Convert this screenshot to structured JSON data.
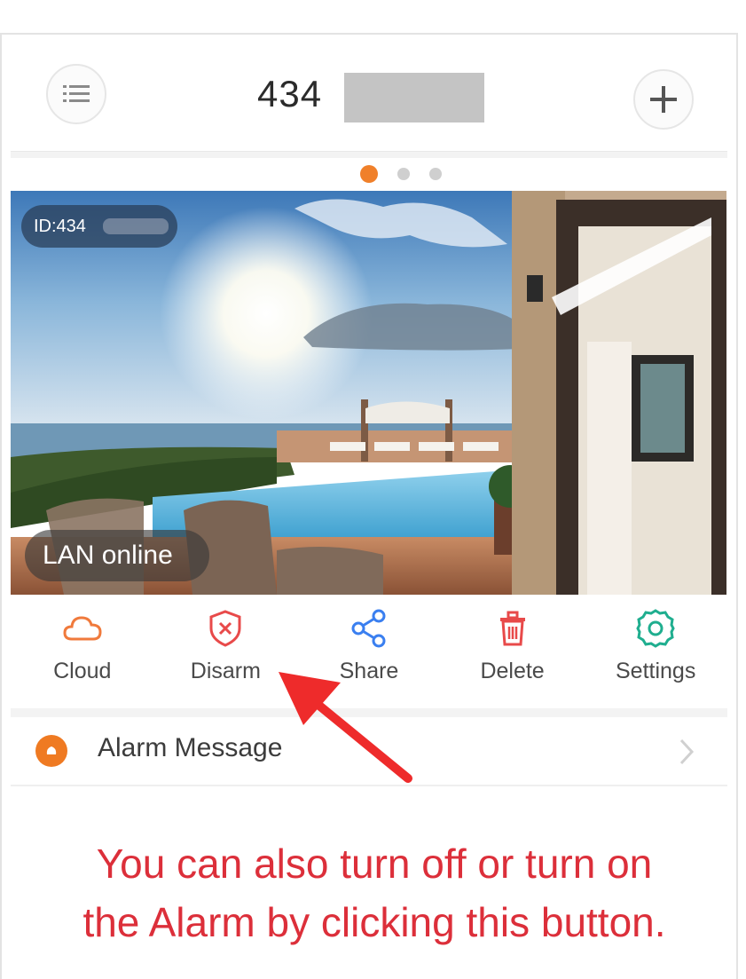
{
  "header": {
    "title_visible": "434",
    "menu_icon": "list-icon",
    "add_icon": "plus-icon"
  },
  "pager": {
    "count": 3,
    "active_index": 0
  },
  "camera": {
    "id_label": "ID:434",
    "status": "LAN online"
  },
  "actions": [
    {
      "label": "Cloud",
      "icon": "cloud-icon",
      "color": "#f07a3c"
    },
    {
      "label": "Disarm",
      "icon": "shield-x-icon",
      "color": "#e84a4a"
    },
    {
      "label": "Share",
      "icon": "share-icon",
      "color": "#3a7ff0"
    },
    {
      "label": "Delete",
      "icon": "trash-icon",
      "color": "#e84a4a"
    },
    {
      "label": "Settings",
      "icon": "gear-icon",
      "color": "#1fae8f"
    }
  ],
  "alarm": {
    "label": "Alarm Message",
    "icon": "alarm-icon",
    "color": "#ef7a22"
  },
  "caption": {
    "line1": "You can also turn off or turn on",
    "line2": "the Alarm by clicking this button."
  },
  "colors": {
    "accent": "#f0802a",
    "caption": "#dc2f3a",
    "arrow": "#ee2b2b"
  }
}
